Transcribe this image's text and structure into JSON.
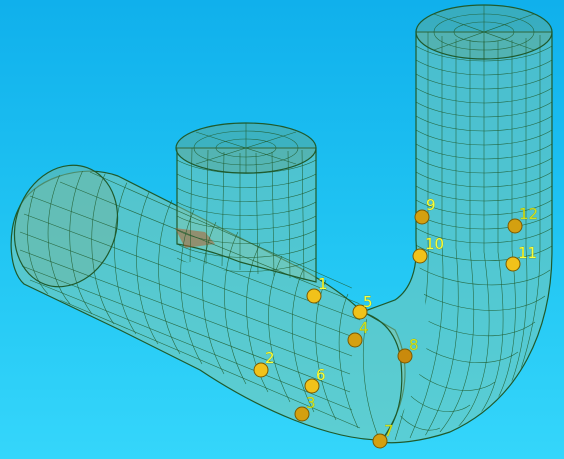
{
  "viewport": {
    "background_top": "#10b0ec",
    "background_bottom": "#35d6fb"
  },
  "model": {
    "fill_color": "#7fc8b0",
    "mesh_color": "#1f5a2c",
    "inner_shadow_color": "#b06030"
  },
  "points": {
    "color": "#f1c21a",
    "label_color": "#f7ff3a",
    "items": [
      {
        "label": "1"
      },
      {
        "label": "2"
      },
      {
        "label": "3"
      },
      {
        "label": "4"
      },
      {
        "label": "5"
      },
      {
        "label": "6"
      },
      {
        "label": "7"
      },
      {
        "label": "8"
      },
      {
        "label": "9"
      },
      {
        "label": "10"
      },
      {
        "label": "11"
      },
      {
        "label": "12"
      }
    ]
  }
}
